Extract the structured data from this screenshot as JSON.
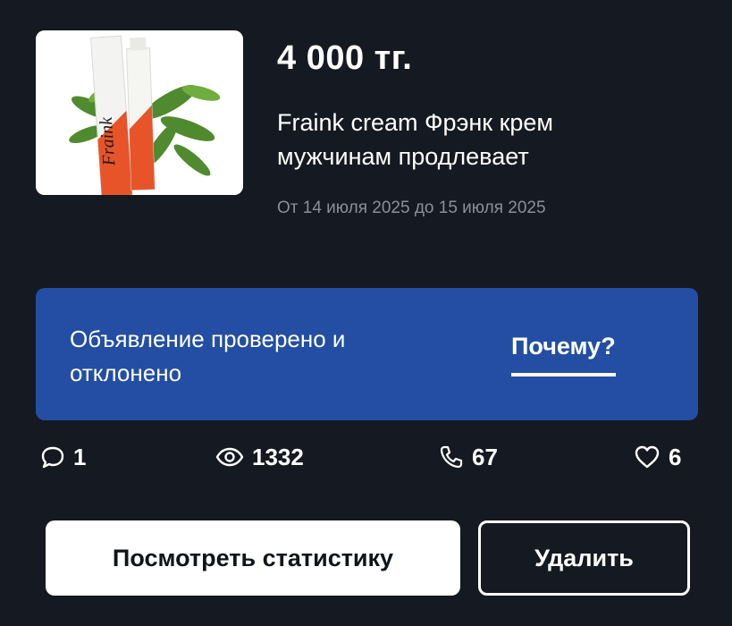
{
  "listing": {
    "price": "4 000 тг.",
    "title": "Fraink cream Фрэнк крем мужчинам продлевает",
    "dates": "От 14 июля 2025 до 15 июля 2025"
  },
  "status": {
    "message": "Объявление проверено и отклонено",
    "why_link": "Почему?",
    "color": "#234ea3"
  },
  "stats": {
    "comments": "1",
    "views": "1332",
    "calls": "67",
    "favorites": "6"
  },
  "actions": {
    "view_stats_label": "Посмотреть статистику",
    "delete_label": "Удалить"
  },
  "icons": {
    "comments": "comment-bubble-icon",
    "views": "eye-icon",
    "calls": "phone-icon",
    "favorites": "heart-icon"
  },
  "colors": {
    "background": "#151922",
    "secondary_text": "#8a8f99"
  }
}
